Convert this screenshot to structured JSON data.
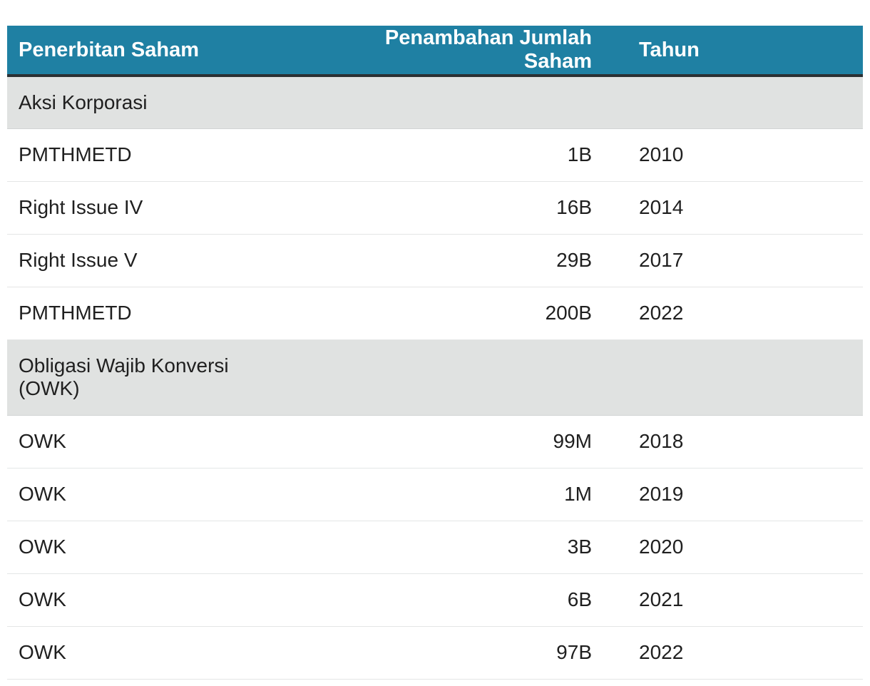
{
  "table": {
    "headers": {
      "issuance": "Penerbitan Saham",
      "added_shares": "Penambahan Jumlah Saham",
      "year": "Tahun"
    },
    "groups": [
      {
        "label": "Aksi Korporasi",
        "rows": [
          {
            "name": "PMTHMETD",
            "shares": "1B",
            "year": "2010"
          },
          {
            "name": "Right Issue IV",
            "shares": "16B",
            "year": "2014"
          },
          {
            "name": "Right Issue V",
            "shares": "29B",
            "year": "2017"
          },
          {
            "name": "PMTHMETD",
            "shares": "200B",
            "year": "2022"
          }
        ]
      },
      {
        "label": "Obligasi Wajib Konversi\n(OWK)",
        "rows": [
          {
            "name": "OWK",
            "shares": "99M",
            "year": "2018"
          },
          {
            "name": "OWK",
            "shares": "1M",
            "year": "2019"
          },
          {
            "name": "OWK",
            "shares": "3B",
            "year": "2020"
          },
          {
            "name": "OWK",
            "shares": "6B",
            "year": "2021"
          },
          {
            "name": "OWK",
            "shares": "97B",
            "year": "2022"
          }
        ]
      }
    ]
  },
  "colors": {
    "header_bg": "#1f80a3",
    "header_border": "#2b3033",
    "group_bg": "#e0e2e1",
    "text": "#1f1f1f"
  }
}
